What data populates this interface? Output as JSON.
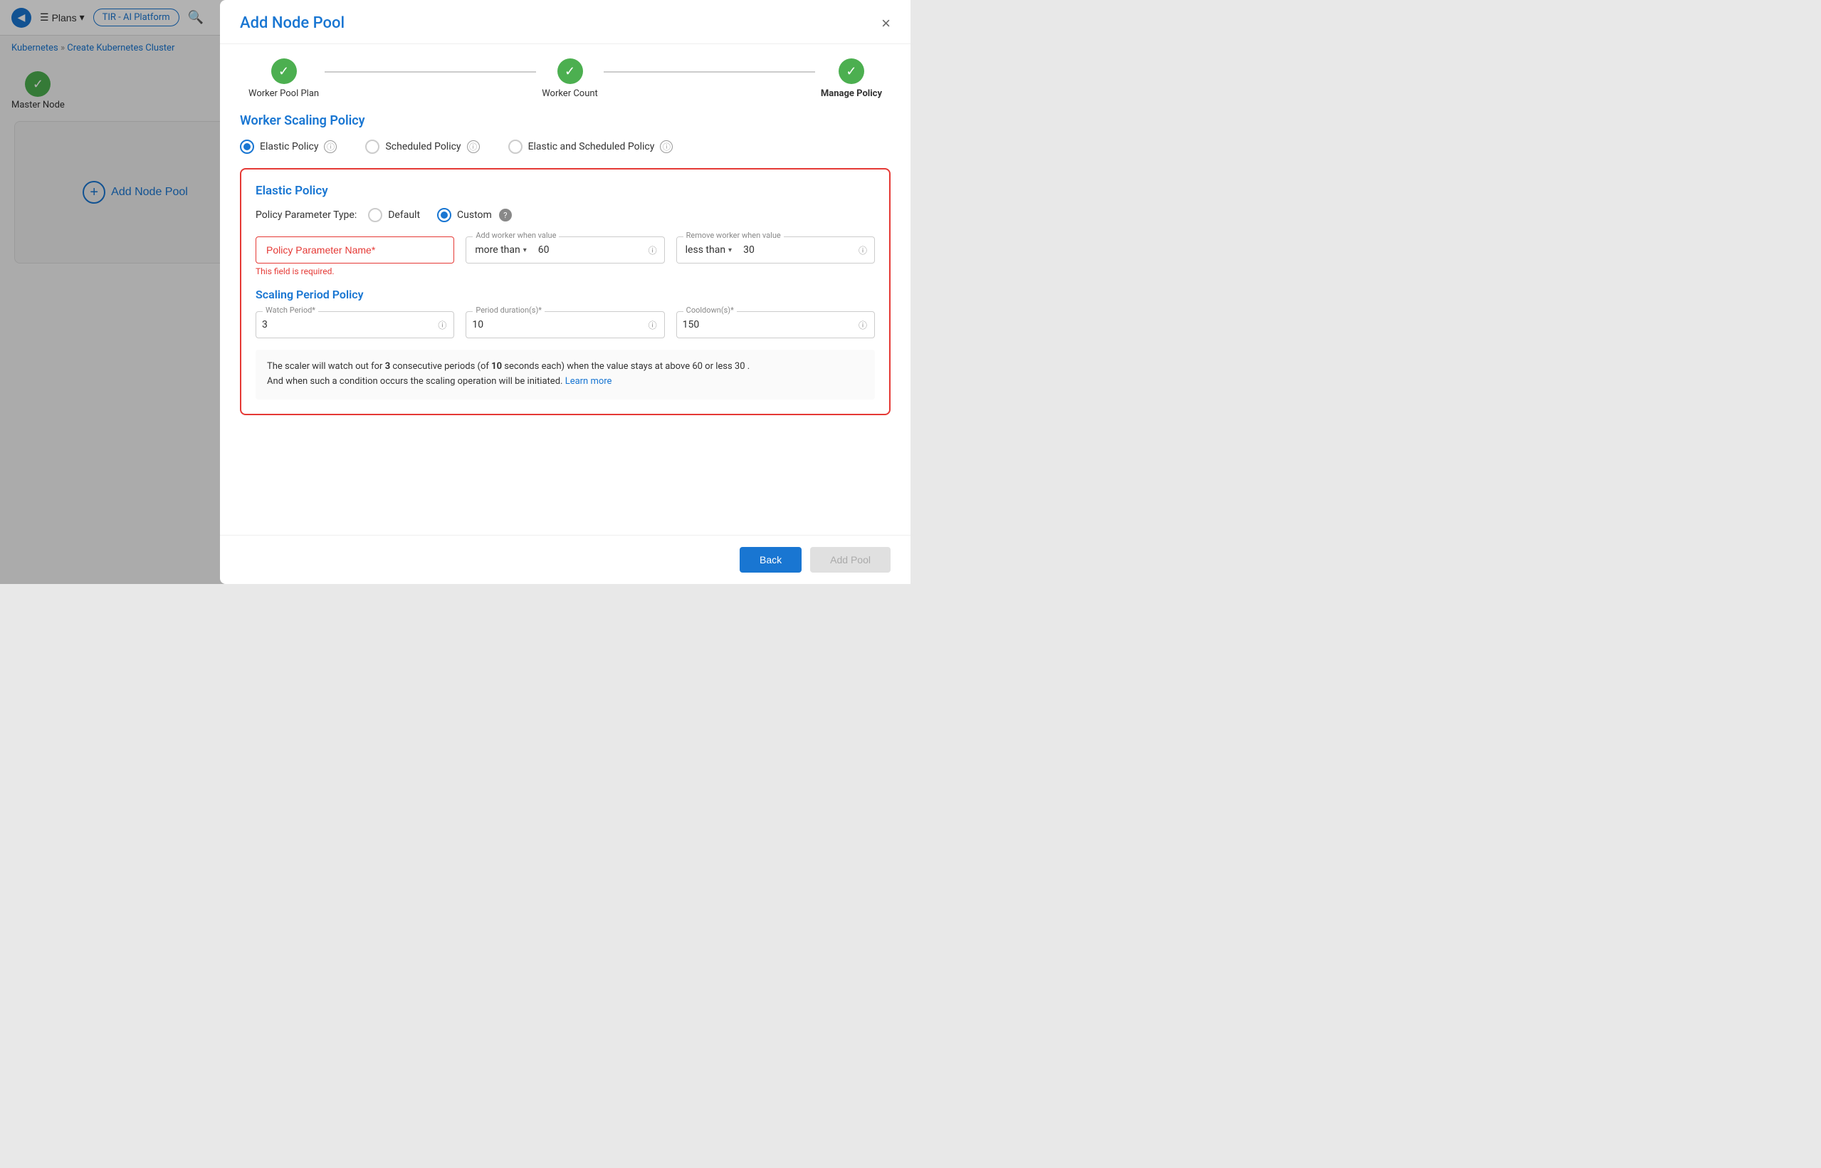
{
  "topbar": {
    "platform_label": "TIR - AI Platform",
    "plans_label": "Plans",
    "back_icon": "◀",
    "search_icon": "🔍"
  },
  "breadcrumb": {
    "kubernetes": "Kubernetes",
    "separator": "»",
    "current": "Create Kubernetes Cluster"
  },
  "sidebar": {
    "master_node_label": "Master Node",
    "add_node_pool_label": "Add Node Pool",
    "plus_icon": "+"
  },
  "modal": {
    "title": "Add Node Pool",
    "close_icon": "×",
    "steps": [
      {
        "label": "Worker Pool Plan",
        "done": true
      },
      {
        "label": "Worker Count",
        "done": true
      },
      {
        "label": "Manage Policy",
        "done": false,
        "active": true
      }
    ],
    "worker_scaling_policy": {
      "title": "Worker Scaling Policy",
      "options": [
        {
          "id": "elastic",
          "label": "Elastic Policy",
          "selected": true
        },
        {
          "id": "scheduled",
          "label": "Scheduled Policy",
          "selected": false
        },
        {
          "id": "elastic_scheduled",
          "label": "Elastic and Scheduled Policy",
          "selected": false
        }
      ]
    },
    "elastic_policy": {
      "title": "Elastic Policy",
      "param_type_label": "Policy Parameter Type:",
      "default_label": "Default",
      "custom_label": "Custom",
      "custom_selected": true,
      "policy_param_name_placeholder": "Policy Parameter Name*",
      "policy_param_error": "This field is required.",
      "add_worker": {
        "legend": "Add worker when value",
        "condition": "more than",
        "value": "60"
      },
      "remove_worker": {
        "legend": "Remove worker when value",
        "condition": "less than",
        "value": "30"
      }
    },
    "scaling_period": {
      "title": "Scaling Period Policy",
      "watch_period_label": "Watch Period*",
      "watch_period_value": "3",
      "period_duration_label": "Period duration(s)*",
      "period_duration_value": "10",
      "cooldown_label": "Cooldown(s)*",
      "cooldown_value": "150"
    },
    "description": {
      "text1": "The scaler will watch out for ",
      "bold1": "3",
      "text2": " consecutive periods (of ",
      "bold2": "10",
      "text3": " seconds each) when the value stays at above 60 or less 30 .",
      "text4": "And when such a condition occurs the scaling operation will be initiated. ",
      "learn_more": "Learn more"
    },
    "footer": {
      "back_label": "Back",
      "add_pool_label": "Add Pool"
    }
  }
}
